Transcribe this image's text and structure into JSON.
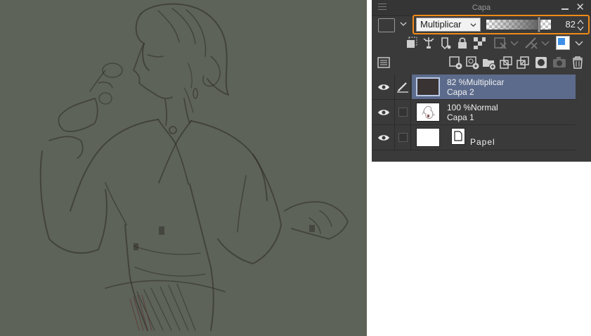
{
  "panel": {
    "title": "Capa",
    "blend_mode": "Multiplicar",
    "opacity_value": "82",
    "opacity_fraction": 0.82,
    "highlight_color": "#f08a17",
    "selected_row_color": "#5c6b8c",
    "canvas_color": "#5d6358"
  },
  "layers": [
    {
      "line1": "82 %Multiplicar",
      "line2": "Capa 2",
      "selected": true
    },
    {
      "line1": "100 %Normal",
      "line2": "Capa 1",
      "selected": false
    },
    {
      "name": "Papel",
      "selected": false
    }
  ]
}
